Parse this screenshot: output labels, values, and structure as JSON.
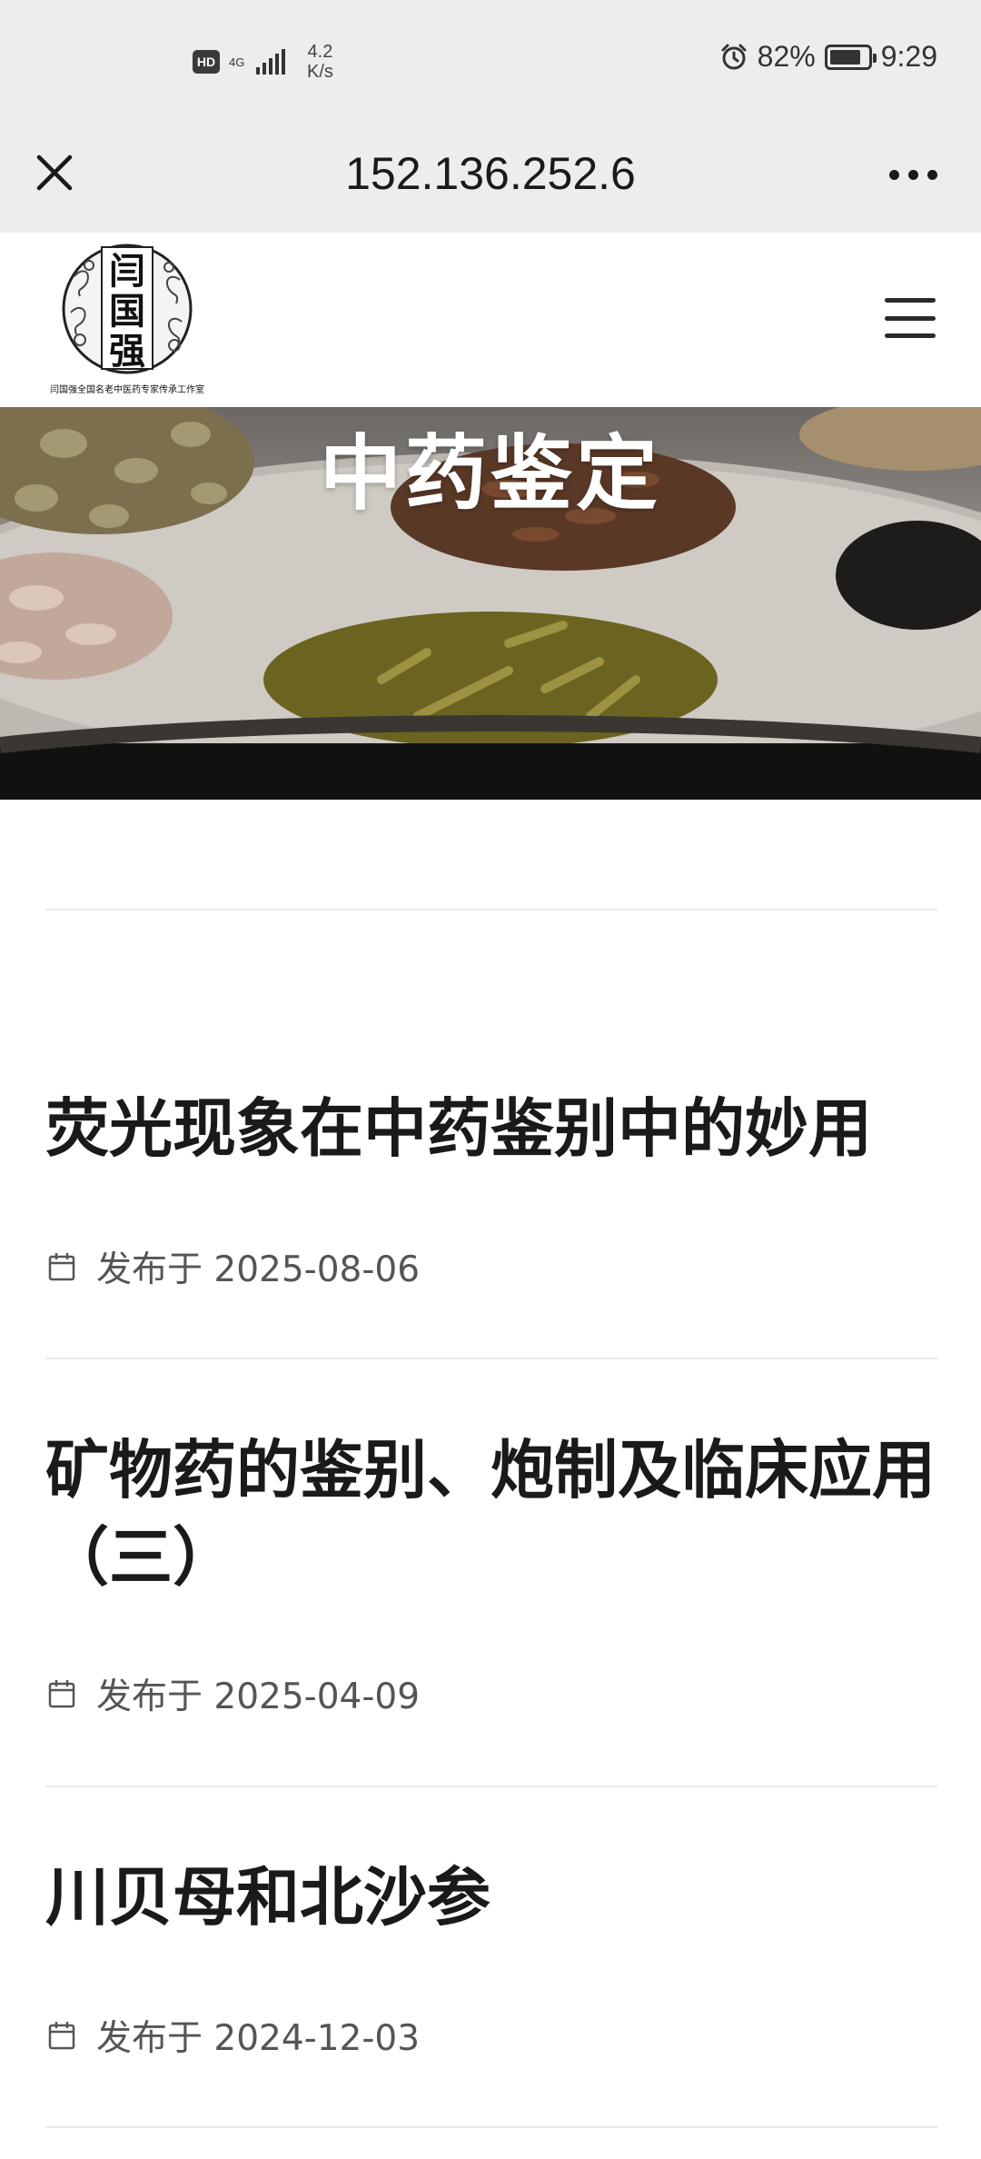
{
  "status_bar": {
    "hd_badge": "HD",
    "network_type": "4G",
    "speed_value": "4.2",
    "speed_unit": "K/s",
    "battery_percent": "82%",
    "battery_level": 0.82,
    "time": "9:29"
  },
  "browser": {
    "url": "152.136.252.6",
    "close_icon": "close-icon",
    "more_icon": "more-icon"
  },
  "site": {
    "logo_chars": "闫国强",
    "logo_caption": "闫国强全国名老中医药专家传承工作室",
    "menu_icon": "hamburger-icon"
  },
  "hero": {
    "title": "中药鉴定"
  },
  "posts": [
    {
      "title": "荧光现象在中药鉴别中的妙用",
      "meta": "发布于 2025-08-06"
    },
    {
      "title": "矿物药的鉴别、炮制及临床应用（三）",
      "meta": "发布于 2025-04-09"
    },
    {
      "title": "川贝母和北沙参",
      "meta": "发布于 2024-12-03"
    }
  ],
  "colors": {
    "chrome_background": "#ededed",
    "text_primary": "#1a1a1a",
    "text_meta": "#555555",
    "divider": "#e8e8e8"
  }
}
